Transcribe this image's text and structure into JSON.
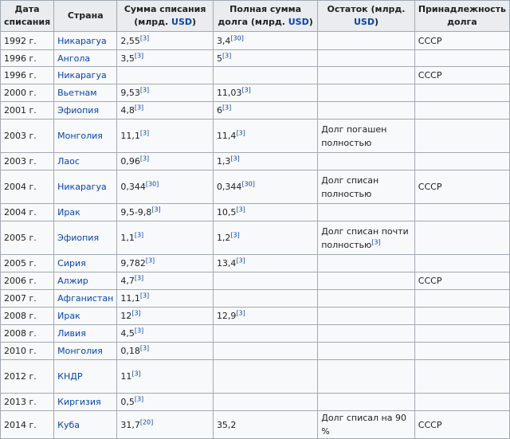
{
  "headers": {
    "date": "Дата списания",
    "country": "Страна",
    "writeoff_pre": "Сумма списания (млрд. ",
    "total_pre": "Полная сумма долга (млрд. ",
    "rest_pre": "Остаток (млрд. ",
    "usd": "USD",
    "close": ")",
    "owner": "Принадлежность долга"
  },
  "rows": [
    {
      "date": "1992 г.",
      "country": "Никарагуа",
      "writeoff": "2,55",
      "writeoff_ref": "[3]",
      "total": "3,4",
      "total_ref": "[30]",
      "rest": "",
      "rest_ref": "",
      "owner": "СССР"
    },
    {
      "date": "1996 г.",
      "country": "Ангола",
      "writeoff": "3,5",
      "writeoff_ref": "[3]",
      "total": "5",
      "total_ref": "[3]",
      "rest": "",
      "rest_ref": "",
      "owner": ""
    },
    {
      "date": "1996 г.",
      "country": "Никарагуа",
      "writeoff": "",
      "writeoff_ref": "",
      "total": "",
      "total_ref": "",
      "rest": "",
      "rest_ref": "",
      "owner": "СССР"
    },
    {
      "date": "2000 г.",
      "country": "Вьетнам",
      "writeoff": "9,53",
      "writeoff_ref": "[3]",
      "total": "11,03",
      "total_ref": "[3]",
      "rest": "",
      "rest_ref": "",
      "owner": ""
    },
    {
      "date": "2001 г.",
      "country": "Эфиопия",
      "writeoff": "4,8",
      "writeoff_ref": "[3]",
      "total": "6",
      "total_ref": "[3]",
      "rest": "",
      "rest_ref": "",
      "owner": ""
    },
    {
      "date": "2003 г.",
      "country": "Монголия",
      "writeoff": "11,1",
      "writeoff_ref": "[3]",
      "total": "11,4",
      "total_ref": "[3]",
      "rest": "Долг погашен полностью",
      "rest_ref": "",
      "owner": ""
    },
    {
      "date": "2003 г.",
      "country": "Лаос",
      "writeoff": "0,96",
      "writeoff_ref": "[3]",
      "total": "1,3",
      "total_ref": "[3]",
      "rest": "",
      "rest_ref": "",
      "owner": ""
    },
    {
      "date": "2004 г.",
      "country": "Никарагуа",
      "writeoff": "0,344",
      "writeoff_ref": "[30]",
      "total": "0,344",
      "total_ref": "[30]",
      "rest": "Долг списан полностью",
      "rest_ref": "",
      "owner": "СССР"
    },
    {
      "date": "2004 г.",
      "country": "Ирак",
      "writeoff": "9,5-9,8",
      "writeoff_ref": "[3]",
      "total": "10,5",
      "total_ref": "[3]",
      "rest": "",
      "rest_ref": "",
      "owner": ""
    },
    {
      "date": "2005 г.",
      "country": "Эфиопия",
      "writeoff": "1,1",
      "writeoff_ref": "[3]",
      "total": "1,2",
      "total_ref": "[3]",
      "rest": "Долг списан почти полностью",
      "rest_ref": "[3]",
      "owner": ""
    },
    {
      "date": "2005 г.",
      "country": "Сирия",
      "writeoff": "9,782",
      "writeoff_ref": "[3]",
      "total": "13,4",
      "total_ref": "[3]",
      "rest": "",
      "rest_ref": "",
      "owner": ""
    },
    {
      "date": "2006 г.",
      "country": "Алжир",
      "writeoff": "4,7",
      "writeoff_ref": "[3]",
      "total": "",
      "total_ref": "",
      "rest": "",
      "rest_ref": "",
      "owner": "СССР"
    },
    {
      "date": "2007 г.",
      "country": "Афганистан",
      "writeoff": "11,1",
      "writeoff_ref": "[3]",
      "total": "",
      "total_ref": "",
      "rest": "",
      "rest_ref": "",
      "owner": ""
    },
    {
      "date": "2008 г.",
      "country": "Ирак",
      "writeoff": "12",
      "writeoff_ref": "[3]",
      "total": "12,9",
      "total_ref": "[3]",
      "rest": "",
      "rest_ref": "",
      "owner": ""
    },
    {
      "date": "2008 г.",
      "country": "Ливия",
      "writeoff": "4,5",
      "writeoff_ref": "[3]",
      "total": "",
      "total_ref": "",
      "rest": "",
      "rest_ref": "",
      "owner": ""
    },
    {
      "date": "2010 г.",
      "country": "Монголия",
      "writeoff": "0,18",
      "writeoff_ref": "[3]",
      "total": "",
      "total_ref": "",
      "rest": "",
      "rest_ref": "",
      "owner": ""
    },
    {
      "date": "2012 г.",
      "country": "КНДР",
      "writeoff": "11",
      "writeoff_ref": "[3]",
      "total": "",
      "total_ref": "",
      "rest": "",
      "rest_ref": "",
      "owner": ""
    },
    {
      "date": "2013 г.",
      "country": "Киргизия",
      "writeoff": "0,5",
      "writeoff_ref": "[3]",
      "total": "",
      "total_ref": "",
      "rest": "",
      "rest_ref": "",
      "owner": ""
    },
    {
      "date": "2014 г.",
      "country": "Куба",
      "writeoff": "31,7",
      "writeoff_ref": "[20]",
      "total": "35,2",
      "total_ref": "",
      "rest": "Долг списал на 90 %",
      "rest_ref": "",
      "owner": "СССР"
    }
  ],
  "colors": {
    "link": "#0645ad",
    "header_bg": "#eaecf0",
    "cell_bg": "#f8f9fa",
    "border": "#a2a9b1"
  }
}
